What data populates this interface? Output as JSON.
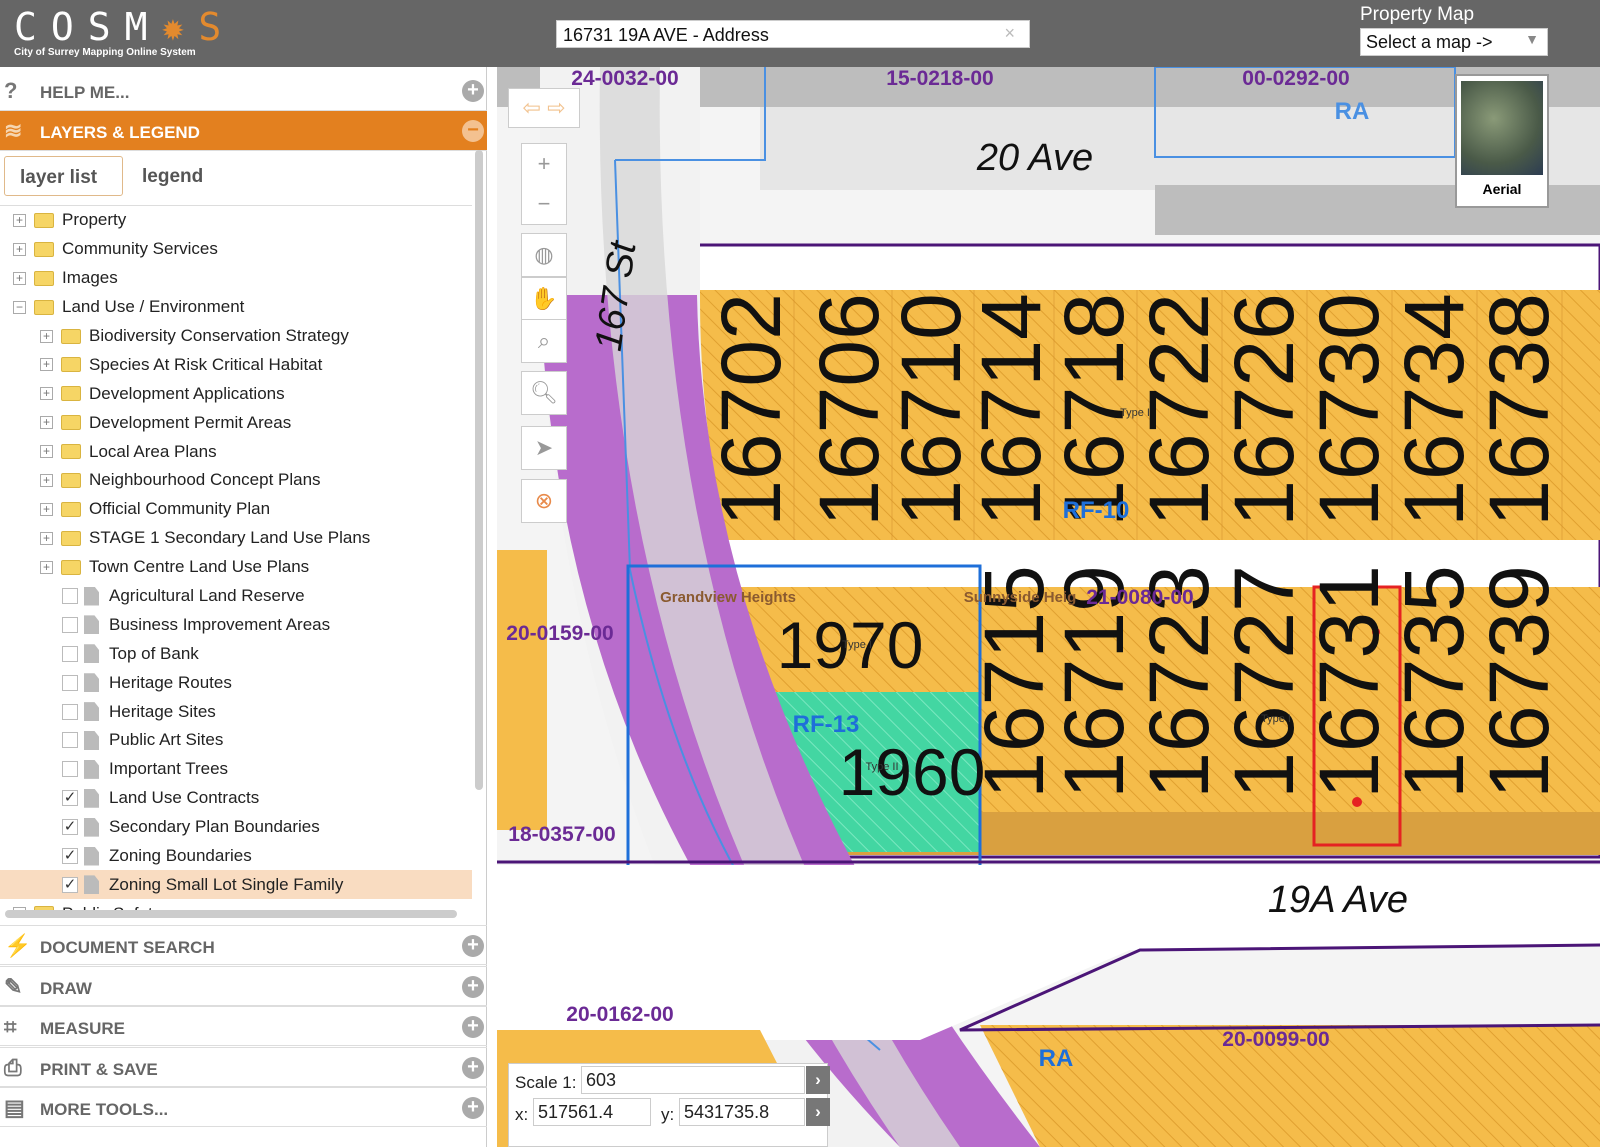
{
  "header": {
    "logo_letters": "COSM",
    "logo_last": "S",
    "logo_subtitle": "City of Surrey Mapping Online System",
    "search_value": "16731 19A AVE - Address",
    "clear": "×",
    "property_map_label": "Property Map",
    "map_select": "Select a map ->"
  },
  "sidebar": {
    "help": "HELP ME...",
    "layers": "LAYERS & LEGEND",
    "tabs": [
      "layer list",
      "legend"
    ],
    "tree": [
      {
        "label": "Property",
        "level": 0,
        "type": "folder",
        "exp": "+"
      },
      {
        "label": "Community Services",
        "level": 0,
        "type": "folder",
        "exp": "+"
      },
      {
        "label": "Images",
        "level": 0,
        "type": "folder",
        "exp": "+"
      },
      {
        "label": "Land Use / Environment",
        "level": 0,
        "type": "folder",
        "exp": "−"
      },
      {
        "label": "Biodiversity Conservation Strategy",
        "level": 1,
        "type": "folder",
        "exp": "+"
      },
      {
        "label": "Species At Risk Critical Habitat",
        "level": 1,
        "type": "folder",
        "exp": "+"
      },
      {
        "label": "Development Applications",
        "level": 1,
        "type": "folder",
        "exp": "+"
      },
      {
        "label": "Development Permit Areas",
        "level": 1,
        "type": "folder",
        "exp": "+"
      },
      {
        "label": "Local Area Plans",
        "level": 1,
        "type": "folder",
        "exp": "+"
      },
      {
        "label": "Neighbourhood Concept Plans",
        "level": 1,
        "type": "folder",
        "exp": "+"
      },
      {
        "label": "Official Community Plan",
        "level": 1,
        "type": "folder",
        "exp": "+"
      },
      {
        "label": "STAGE 1 Secondary Land Use Plans",
        "level": 1,
        "type": "folder",
        "exp": "+"
      },
      {
        "label": "Town Centre Land Use Plans",
        "level": 1,
        "type": "folder",
        "exp": "+"
      },
      {
        "label": "Agricultural Land Reserve",
        "level": 1,
        "type": "layer",
        "checked": false
      },
      {
        "label": "Business Improvement Areas",
        "level": 1,
        "type": "layer",
        "checked": false
      },
      {
        "label": "Top of Bank",
        "level": 1,
        "type": "layer",
        "checked": false
      },
      {
        "label": "Heritage Routes",
        "level": 1,
        "type": "layer",
        "checked": false
      },
      {
        "label": "Heritage Sites",
        "level": 1,
        "type": "layer",
        "checked": false
      },
      {
        "label": "Public Art Sites",
        "level": 1,
        "type": "layer",
        "checked": false
      },
      {
        "label": "Important Trees",
        "level": 1,
        "type": "layer",
        "checked": false
      },
      {
        "label": "Land Use Contracts",
        "level": 1,
        "type": "layer",
        "checked": true
      },
      {
        "label": "Secondary Plan Boundaries",
        "level": 1,
        "type": "layer",
        "checked": true
      },
      {
        "label": "Zoning Boundaries",
        "level": 1,
        "type": "layer",
        "checked": true
      },
      {
        "label": "Zoning Small Lot Single Family",
        "level": 1,
        "type": "layer",
        "checked": true,
        "selected": true
      },
      {
        "label": "Public Safety",
        "level": 0,
        "type": "folder",
        "exp": "+"
      }
    ],
    "bottom": [
      "DOCUMENT SEARCH",
      "DRAW",
      "MEASURE",
      "PRINT & SAVE",
      "MORE TOOLS..."
    ]
  },
  "map": {
    "streets": [
      "20 Ave",
      "167 St",
      "19A Ave"
    ],
    "projects": [
      "24-0032-00",
      "15-0218-00",
      "00-0292-00",
      "20-0159-00",
      "18-0357-00",
      "21-0080-00",
      "20-0162-00",
      "20-0099-00"
    ],
    "zones": [
      "RA",
      "RF-10",
      "RF-13",
      "RA"
    ],
    "areas": [
      "Grandview Heights",
      "Sunnyside Heig"
    ],
    "types": [
      "Type I",
      "Type I",
      "Type I",
      "Type II"
    ],
    "upper_lots": [
      "16702",
      "16706",
      "16710",
      "16714",
      "16718",
      "16722",
      "16726",
      "16730",
      "16734",
      "16738"
    ],
    "lower_lots": [
      "16715",
      "16719",
      "16723",
      "16727",
      "16731",
      "16735",
      "16739"
    ],
    "lots_horizontal": [
      "1970",
      "1960"
    ],
    "selected_lot": "16731",
    "aerial_label": "Aerial",
    "scale_label": "Scale 1:",
    "scale_value": "603",
    "x_label": "x:",
    "x_value": "517561.4",
    "y_label": "y:",
    "y_value": "5431735.8",
    "colors": {
      "zone": "#f5bc4a",
      "purple": "#b86ccc",
      "green": "#43d6a2",
      "selection": "#e52222",
      "accent": "#e3801f"
    }
  }
}
